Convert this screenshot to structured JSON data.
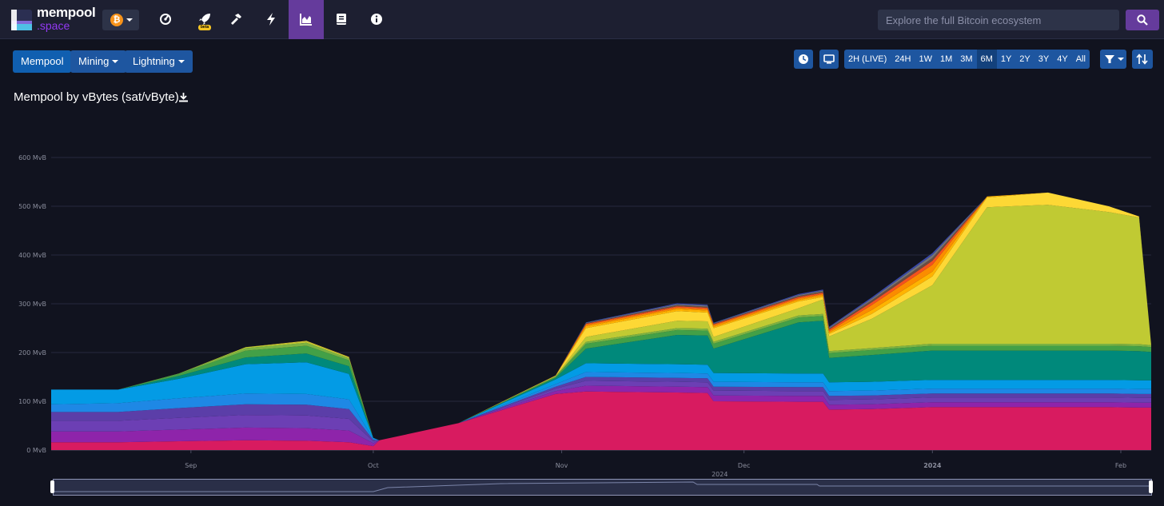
{
  "header": {
    "logo_line1": "mempool",
    "logo_line2": ".space",
    "network_symbol": "₿",
    "beta_label": "beta",
    "search_placeholder": "Explore the full Bitcoin ecosystem",
    "nav_icons": [
      "dashboard-icon",
      "rocket-icon",
      "hammer-icon",
      "lightning-icon",
      "graphs-icon",
      "docs-icon",
      "about-icon"
    ],
    "active_nav": "graphs-icon"
  },
  "subnav": {
    "mempool_label": "Mempool",
    "mining_label": "Mining",
    "lightning_label": "Lightning"
  },
  "ranges": {
    "items": [
      "2H (LIVE)",
      "24H",
      "1W",
      "1M",
      "3M",
      "6M",
      "1Y",
      "2Y",
      "3Y",
      "4Y",
      "All"
    ],
    "active": "6M"
  },
  "chart_title": "Mempool by vBytes (sat/vByte)",
  "chart_data": {
    "type": "area",
    "stacked": true,
    "title": "Mempool by vBytes (sat/vByte)",
    "ylim": [
      0,
      600
    ],
    "ytick_labels": [
      "0 MvB",
      "100 MvB",
      "200 MvB",
      "300 MvB",
      "400 MvB",
      "500 MvB",
      "600 MvB"
    ],
    "ytick_values": [
      0,
      100,
      200,
      300,
      400,
      500,
      600
    ],
    "xtick_labels": [
      "Sep",
      "Oct",
      "Nov",
      "Dec",
      "2024",
      "Feb"
    ],
    "xtick_dates": [
      "2023-09-01",
      "2023-10-01",
      "2023-11-01",
      "2023-12-01",
      "2024-01-01",
      "2024-02-01"
    ],
    "x_range": [
      "2023-08-09",
      "2024-02-06"
    ],
    "year_label": "2024",
    "x": [
      "2023-08-09",
      "2023-08-20",
      "2023-08-30",
      "2023-09-10",
      "2023-09-20",
      "2023-09-27",
      "2023-10-01",
      "2023-10-02",
      "2023-10-15",
      "2023-10-31",
      "2023-11-05",
      "2023-11-20",
      "2023-11-25",
      "2023-11-26",
      "2023-12-10",
      "2023-12-14",
      "2023-12-15",
      "2023-12-22",
      "2024-01-01",
      "2024-01-10",
      "2024-01-20",
      "2024-01-30",
      "2024-02-04",
      "2024-02-06"
    ],
    "series": [
      {
        "color": "#d81b60",
        "values": [
          16,
          16,
          18,
          20,
          19,
          16,
          8,
          20,
          55,
          115,
          120,
          118,
          117,
          100,
          99,
          99,
          83,
          84,
          88,
          88,
          88,
          88,
          87,
          87
        ]
      },
      {
        "color": "#8e24aa",
        "values": [
          22,
          22,
          24,
          26,
          26,
          24,
          6,
          0,
          0,
          6,
          12,
          12,
          12,
          12,
          12,
          12,
          10,
          10,
          10,
          10,
          10,
          10,
          10,
          10
        ]
      },
      {
        "color": "#6c3fb4",
        "values": [
          22,
          22,
          24,
          26,
          26,
          24,
          4,
          0,
          0,
          5,
          10,
          10,
          10,
          10,
          10,
          10,
          10,
          10,
          10,
          10,
          10,
          10,
          10,
          10
        ]
      },
      {
        "color": "#5b3ea8",
        "values": [
          18,
          18,
          20,
          22,
          22,
          20,
          3,
          0,
          0,
          4,
          8,
          8,
          8,
          8,
          8,
          8,
          8,
          8,
          8,
          8,
          8,
          8,
          8,
          8
        ]
      },
      {
        "color": "#1e88e5",
        "values": [
          16,
          18,
          20,
          22,
          22,
          20,
          2,
          0,
          0,
          5,
          10,
          10,
          10,
          10,
          10,
          10,
          10,
          10,
          10,
          10,
          10,
          10,
          10,
          10
        ]
      },
      {
        "color": "#039be5",
        "values": [
          30,
          28,
          40,
          60,
          65,
          52,
          2,
          0,
          0,
          10,
          18,
          18,
          18,
          18,
          18,
          18,
          18,
          18,
          18,
          18,
          18,
          18,
          18,
          18
        ]
      },
      {
        "color": "#00897b",
        "values": [
          0,
          0,
          6,
          14,
          18,
          16,
          0,
          0,
          0,
          3,
          30,
          60,
          60,
          50,
          105,
          108,
          50,
          55,
          60,
          60,
          60,
          60,
          60,
          58
        ]
      },
      {
        "color": "#43a047",
        "values": [
          0,
          0,
          4,
          14,
          16,
          12,
          0,
          0,
          0,
          2,
          10,
          10,
          10,
          10,
          10,
          10,
          10,
          10,
          10,
          10,
          10,
          10,
          10,
          10
        ]
      },
      {
        "color": "#7cb342",
        "values": [
          0,
          0,
          1,
          5,
          6,
          4,
          0,
          0,
          0,
          1,
          4,
          4,
          4,
          4,
          4,
          4,
          4,
          4,
          4,
          4,
          4,
          4,
          4,
          4
        ]
      },
      {
        "color": "#c0ca33",
        "values": [
          0,
          0,
          0,
          2,
          3,
          2,
          0,
          0,
          0,
          1,
          10,
          15,
          15,
          10,
          15,
          30,
          30,
          60,
          120,
          280,
          285,
          270,
          260,
          0
        ]
      },
      {
        "color": "#fdd835",
        "values": [
          0,
          0,
          0,
          0,
          1,
          1,
          0,
          0,
          0,
          1,
          18,
          20,
          18,
          18,
          14,
          5,
          5,
          10,
          18,
          20,
          25,
          12,
          2,
          0
        ]
      },
      {
        "color": "#ffb300",
        "values": [
          0,
          0,
          0,
          0,
          0,
          0,
          0,
          0,
          0,
          0,
          4,
          4,
          4,
          3,
          3,
          3,
          3,
          8,
          10,
          2,
          0,
          0,
          0,
          0
        ]
      },
      {
        "color": "#fb8c00",
        "values": [
          0,
          0,
          0,
          0,
          0,
          0,
          0,
          0,
          0,
          0,
          3,
          3,
          3,
          3,
          3,
          3,
          3,
          10,
          14,
          0,
          0,
          0,
          0,
          0
        ]
      },
      {
        "color": "#f4511e",
        "values": [
          0,
          0,
          0,
          0,
          0,
          0,
          0,
          0,
          0,
          0,
          2,
          3,
          3,
          2,
          3,
          3,
          3,
          6,
          8,
          0,
          0,
          0,
          0,
          0
        ]
      },
      {
        "color": "#6d4c41",
        "values": [
          0,
          0,
          0,
          0,
          0,
          0,
          0,
          0,
          0,
          0,
          1,
          2,
          2,
          1,
          2,
          2,
          2,
          4,
          6,
          0,
          0,
          0,
          0,
          0
        ]
      },
      {
        "color": "#757575",
        "values": [
          0,
          0,
          0,
          0,
          0,
          0,
          0,
          0,
          0,
          0,
          1,
          2,
          2,
          1,
          2,
          2,
          2,
          3,
          6,
          0,
          0,
          0,
          0,
          0
        ]
      },
      {
        "color": "#3949ab",
        "values": [
          0,
          0,
          0,
          0,
          0,
          0,
          0,
          0,
          0,
          0,
          1,
          2,
          2,
          1,
          2,
          2,
          2,
          3,
          4,
          0,
          0,
          0,
          0,
          0
        ]
      }
    ]
  }
}
